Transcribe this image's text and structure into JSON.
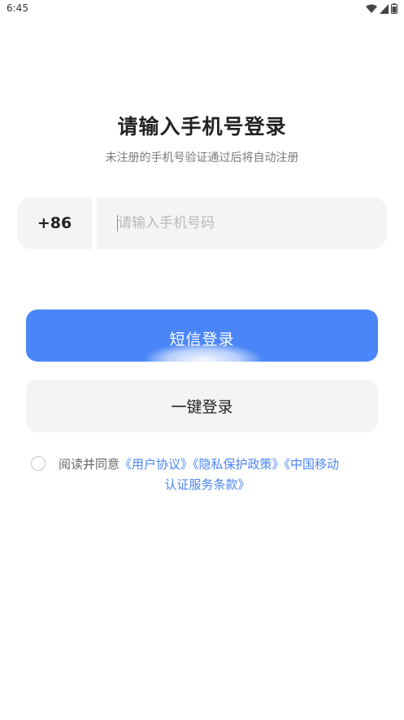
{
  "status_bar": {
    "time": "6:45"
  },
  "header": {
    "title": "请输入手机号登录",
    "subtitle": "未注册的手机号验证通过后将自动注册"
  },
  "phone": {
    "country_code": "+86",
    "placeholder": "请输入手机号码"
  },
  "buttons": {
    "sms_login": "短信登录",
    "one_click_login": "一键登录"
  },
  "agreement": {
    "prefix": "阅读并同意",
    "link_user_agreement": "《用户协议》",
    "link_privacy_policy": "《隐私保护政策》",
    "link_cmcc_part1": "《中国移动",
    "link_cmcc_part2": "认证服务条款》"
  },
  "colors": {
    "primary": "#4a86f7",
    "field_bg": "#f4f4f5",
    "link": "#4a86f7"
  }
}
